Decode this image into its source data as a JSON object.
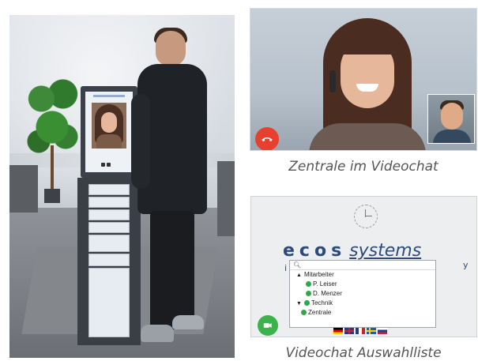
{
  "captions": {
    "videochat": "Zentrale im Videochat",
    "list": "Videochat Auswahlliste"
  },
  "selection_list": {
    "logo_main": "ecos",
    "logo_sub": "systems",
    "logo_small_left": "i",
    "logo_small_right": "y",
    "search_icon": "search-icon",
    "groups": [
      {
        "label": "Mitarbeiter",
        "members": [
          "P. Leiser",
          "D. Menzer"
        ]
      },
      {
        "label": "Technik",
        "members": [
          "Zentrale"
        ]
      }
    ],
    "flags": [
      "de",
      "gb",
      "fr",
      "se",
      "ru"
    ]
  },
  "colors": {
    "hangup": "#e8402f",
    "camera_button": "#3bb34a",
    "online_status": "#2ea84a",
    "logo": "#2c4a7a"
  }
}
